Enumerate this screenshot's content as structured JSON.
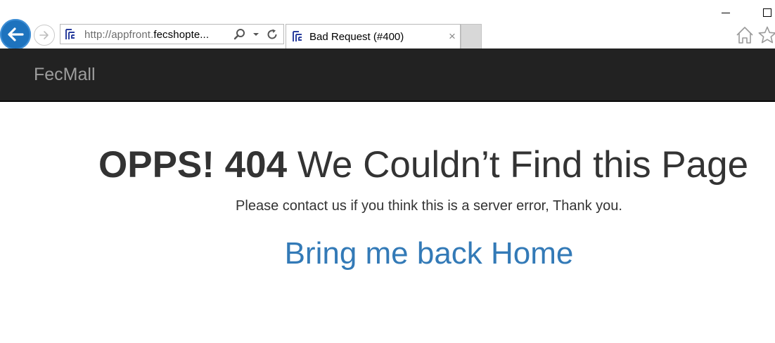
{
  "browser": {
    "url_prefix": "http://appfront.",
    "url_domain": "fecshopte...",
    "tab_title": "Bad Request (#400)",
    "tab_close": "×",
    "icons": {
      "back": "back-arrow-icon",
      "forward": "forward-arrow-icon",
      "search": "search-icon",
      "dropdown": "chevron-down-icon",
      "refresh": "refresh-icon",
      "home": "home-icon",
      "favorites": "star-icon",
      "minimize": "minimize-icon",
      "maximize": "maximize-icon"
    }
  },
  "navbar": {
    "brand": "FecMall"
  },
  "error": {
    "code_label": "OPPS! 404",
    "message": " We Couldn’t Find this Page",
    "subtext": "Please contact us if you think this is a server error, Thank you.",
    "home_link": "Bring me back Home"
  },
  "colors": {
    "navbar_bg": "#222222",
    "brand_text": "#9d9d9d",
    "heading_text": "#333333",
    "link": "#337ab7",
    "back_button": "#1e73be"
  }
}
